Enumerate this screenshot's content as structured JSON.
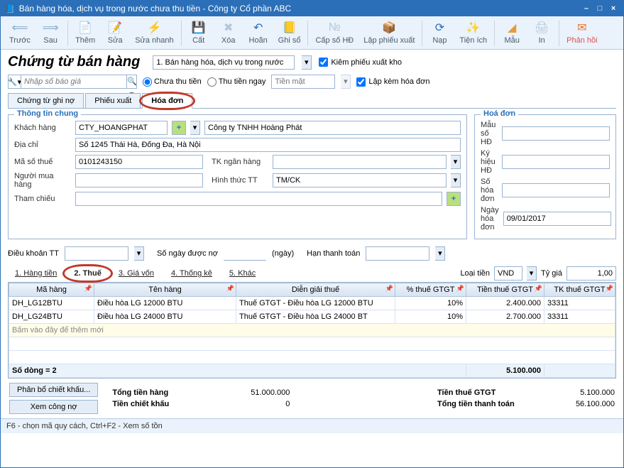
{
  "window": {
    "title": "Bán hàng hóa, dịch vụ trong nước chưa thu tiền - Công ty Cổ phần ABC"
  },
  "toolbar": {
    "prev": "Trước",
    "next": "Sau",
    "add": "Thêm",
    "edit": "Sửa",
    "quickedit": "Sửa nhanh",
    "store": "Cất",
    "del": "Xóa",
    "undo": "Hoãn",
    "post": "Ghi sổ",
    "invoice_no": "Cấp số HĐ",
    "stockout": "Lập phiếu xuất",
    "reload": "Nạp",
    "util": "Tiện ích",
    "template": "Mẫu",
    "print": "In",
    "feedback": "Phản hồi"
  },
  "header": {
    "title": "Chứng từ bán hàng",
    "type_combo": "1. Bán hàng hóa, dịch vụ trong nước",
    "chk_stockout": "Kiêm phiếu xuất kho",
    "search_placeholder": "Nhập số báo giá",
    "radio_not_paid": "Chưa thu tiền",
    "radio_paid_now": "Thu tiền ngay",
    "paymethod_placeholder": "Tiền mặt",
    "chk_with_invoice": "Lập kèm hóa đơn"
  },
  "tabs_top": {
    "t1": "Chứng từ ghi nợ",
    "t2": "Phiếu xuất",
    "t3": "Hóa đơn"
  },
  "genbox": {
    "legend": "Thông tin chung",
    "customer_lbl": "Khách hàng",
    "customer_code": "CTY_HOANGPHAT",
    "customer_name": "Công ty TNHH Hoàng Phát",
    "addr_lbl": "Địa chỉ",
    "addr": "Số 1245 Thái Hà, Đống Đa, Hà Nội",
    "tax_lbl": "Mã số thuế",
    "tax": "0101243150",
    "bank_lbl": "TK ngân hàng",
    "bank": "",
    "buyer_lbl": "Người mua hàng",
    "buyer": "",
    "paytype_lbl": "Hình thức TT",
    "paytype": "TM/CK",
    "ref_lbl": "Tham chiếu"
  },
  "invbox": {
    "legend": "Hoá đơn",
    "tpl_lbl": "Mẫu số HĐ",
    "tpl": "",
    "sym_lbl": "Ký hiệu HĐ",
    "sym": "",
    "no_lbl": "Số hóa đơn",
    "no": "",
    "date_lbl": "Ngày hóa đơn",
    "date": "09/01/2017"
  },
  "mid": {
    "terms_lbl": "Điều khoản TT",
    "days_lbl": "Số ngày được nợ",
    "days_unit": "(ngày)",
    "due_lbl": "Hạn thanh toán"
  },
  "tabs_bot": {
    "t1": "1. Hàng tiền",
    "t2": "2. Thuế",
    "t3": "3. Giá vốn",
    "t4": "4. Thống kê",
    "t5": "5. Khác"
  },
  "curr": {
    "lbl": "Loại tiền",
    "val": "VND",
    "rate_lbl": "Tỷ giá",
    "rate": "1,00"
  },
  "grid": {
    "cols": {
      "code": "Mã hàng",
      "name": "Tên hàng",
      "taxdesc": "Diễn giải thuế",
      "vatpct": "% thuế GTGT",
      "vatamt": "Tiền thuế GTGT",
      "vatacc": "TK thuế GTGT"
    },
    "rows": [
      {
        "code": "DH_LG12BTU",
        "name": "Điều hòa LG 12000 BTU",
        "taxdesc": "Thuế GTGT - Điều hòa LG 12000 BTU",
        "vatpct": "10%",
        "vatamt": "2.400.000",
        "vatacc": "33311"
      },
      {
        "code": "DH_LG24BTU",
        "name": "Điều hòa LG 24000 BTU",
        "taxdesc": "Thuế GTGT - Điều hòa LG 24000 BT",
        "vatpct": "10%",
        "vatamt": "2.700.000",
        "vatacc": "33311"
      }
    ],
    "newrow": "Bấm vào đây để thêm mới",
    "rowcount": "Số dòng = 2",
    "total_vat": "5.100.000"
  },
  "summary": {
    "btn_discount": "Phân bổ chiết khấu...",
    "btn_receivable": "Xem công nợ",
    "goods_lbl": "Tổng tiền hàng",
    "goods": "51.000.000",
    "disc_lbl": "Tiền chiết khấu",
    "disc": "0",
    "vat_lbl": "Tiền thuế GTGT",
    "vat": "5.100.000",
    "total_lbl": "Tổng tiền thanh toán",
    "total": "56.100.000"
  },
  "status": "F6 - chọn mã quy cách, Ctrl+F2 - Xem số tồn"
}
